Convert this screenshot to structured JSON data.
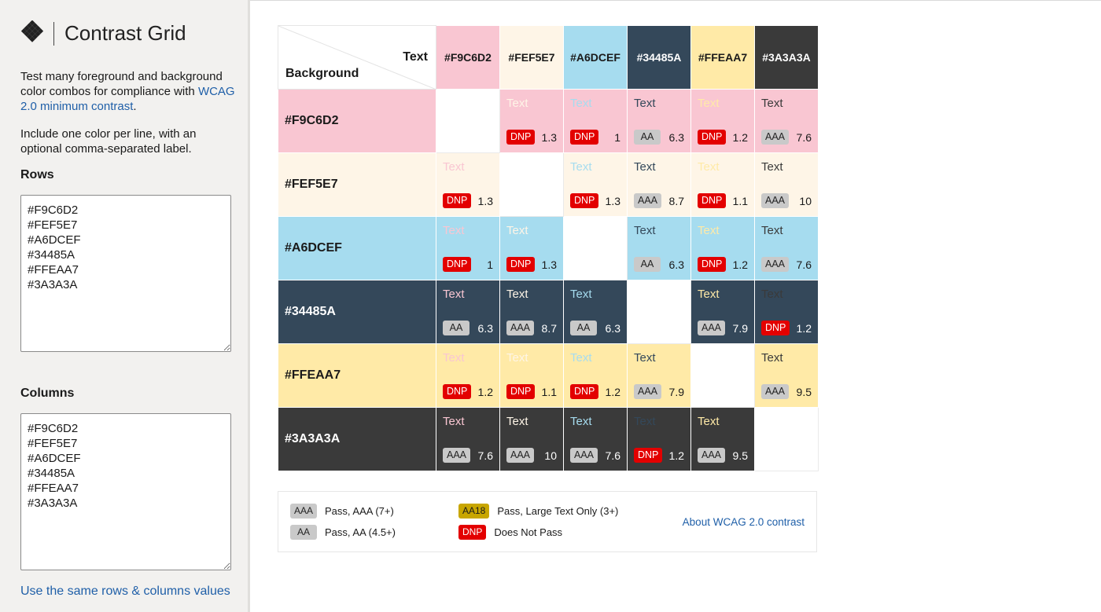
{
  "app": {
    "title": "Contrast Grid",
    "description_prefix": "Test many foreground and background color combos for compliance with ",
    "description_link": "WCAG 2.0 minimum contrast",
    "description_suffix": ".",
    "instructions": "Include one color per line, with an optional comma-separated label."
  },
  "rows_section": {
    "label": "Rows",
    "value": "#F9C6D2\n#FEF5E7\n#A6DCEF\n#34485A\n#FFEAA7\n#3A3A3A"
  },
  "columns_section": {
    "label": "Columns",
    "value": "#F9C6D2\n#FEF5E7\n#A6DCEF\n#34485A\n#FFEAA7\n#3A3A3A"
  },
  "same_values_link": "Use the same rows & columns values",
  "grid": {
    "corner_text": "Text",
    "corner_background": "Background",
    "sample_text": "Text",
    "colors": [
      {
        "label": "#F9C6D2",
        "hex": "#F9C6D2",
        "text_color": "#1a1a1a"
      },
      {
        "label": "#FEF5E7",
        "hex": "#FEF5E7",
        "text_color": "#1a1a1a"
      },
      {
        "label": "#A6DCEF",
        "hex": "#A6DCEF",
        "text_color": "#1a1a1a"
      },
      {
        "label": "#34485A",
        "hex": "#34485A",
        "text_color": "#ffffff"
      },
      {
        "label": "#FFEAA7",
        "hex": "#FFEAA7",
        "text_color": "#1a1a1a"
      },
      {
        "label": "#3A3A3A",
        "hex": "#3A3A3A",
        "text_color": "#ffffff"
      }
    ],
    "cells": [
      [
        null,
        {
          "badge": "DNP",
          "ratio": "1.3"
        },
        {
          "badge": "DNP",
          "ratio": "1"
        },
        {
          "badge": "AA",
          "ratio": "6.3"
        },
        {
          "badge": "DNP",
          "ratio": "1.2"
        },
        {
          "badge": "AAA",
          "ratio": "7.6"
        }
      ],
      [
        {
          "badge": "DNP",
          "ratio": "1.3"
        },
        null,
        {
          "badge": "DNP",
          "ratio": "1.3"
        },
        {
          "badge": "AAA",
          "ratio": "8.7"
        },
        {
          "badge": "DNP",
          "ratio": "1.1"
        },
        {
          "badge": "AAA",
          "ratio": "10"
        }
      ],
      [
        {
          "badge": "DNP",
          "ratio": "1"
        },
        {
          "badge": "DNP",
          "ratio": "1.3"
        },
        null,
        {
          "badge": "AA",
          "ratio": "6.3"
        },
        {
          "badge": "DNP",
          "ratio": "1.2"
        },
        {
          "badge": "AAA",
          "ratio": "7.6"
        }
      ],
      [
        {
          "badge": "AA",
          "ratio": "6.3"
        },
        {
          "badge": "AAA",
          "ratio": "8.7"
        },
        {
          "badge": "AA",
          "ratio": "6.3"
        },
        null,
        {
          "badge": "AAA",
          "ratio": "7.9"
        },
        {
          "badge": "DNP",
          "ratio": "1.2"
        }
      ],
      [
        {
          "badge": "DNP",
          "ratio": "1.2"
        },
        {
          "badge": "DNP",
          "ratio": "1.1"
        },
        {
          "badge": "DNP",
          "ratio": "1.2"
        },
        {
          "badge": "AAA",
          "ratio": "7.9"
        },
        null,
        {
          "badge": "AAA",
          "ratio": "9.5"
        }
      ],
      [
        {
          "badge": "AAA",
          "ratio": "7.6"
        },
        {
          "badge": "AAA",
          "ratio": "10"
        },
        {
          "badge": "AAA",
          "ratio": "7.6"
        },
        {
          "badge": "DNP",
          "ratio": "1.2"
        },
        {
          "badge": "AAA",
          "ratio": "9.5"
        },
        null
      ]
    ]
  },
  "legend": {
    "items": [
      {
        "badge": "AAA",
        "text": "Pass, AAA (7+)",
        "style": "grey"
      },
      {
        "badge": "AA",
        "text": "Pass, AA (4.5+)",
        "style": "grey"
      },
      {
        "badge": "AA18",
        "text": "Pass, Large Text Only (3+)",
        "style": "yellow"
      },
      {
        "badge": "DNP",
        "text": "Does Not Pass",
        "style": "red"
      }
    ],
    "about_link": "About WCAG 2.0 contrast"
  },
  "colors": {
    "link": "#1f5fa8",
    "dnp_badge": "#e30000",
    "pass_badge": "#c9c9c9",
    "large_text_badge": "#c8a600",
    "sidebar_bg": "#f2f1ef"
  },
  "icons": {
    "logo": "checkered-diamond-logo-icon"
  }
}
